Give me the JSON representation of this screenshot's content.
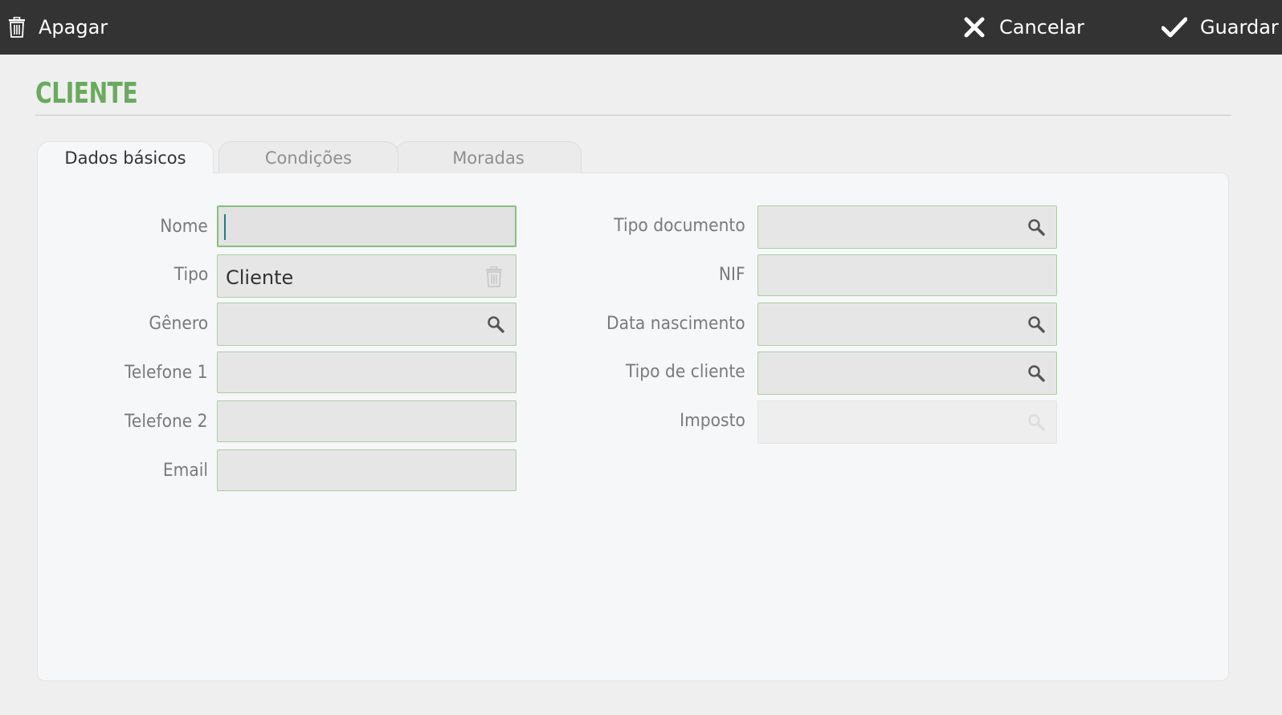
{
  "toolbar": {
    "delete_label": "Apagar",
    "cancel_label": "Cancelar",
    "save_label": "Guardar"
  },
  "page": {
    "title": "CLIENTE"
  },
  "tabs": [
    {
      "label": "Dados básicos",
      "active": true
    },
    {
      "label": "Condições",
      "active": false
    },
    {
      "label": "Moradas",
      "active": false
    }
  ],
  "form": {
    "left": [
      {
        "label": "Nome",
        "value": "",
        "icon": "none",
        "state": "focused"
      },
      {
        "label": "Tipo",
        "value": "Cliente",
        "icon": "trash-icon",
        "state": "normal"
      },
      {
        "label": "Gênero",
        "value": "",
        "icon": "search-icon",
        "state": "normal"
      },
      {
        "label": "Telefone 1",
        "value": "",
        "icon": "none",
        "state": "normal"
      },
      {
        "label": "Telefone 2",
        "value": "",
        "icon": "none",
        "state": "normal"
      },
      {
        "label": "Email",
        "value": "",
        "icon": "none",
        "state": "normal"
      }
    ],
    "right": [
      {
        "label": "Tipo documento",
        "value": "",
        "icon": "search-icon",
        "state": "normal"
      },
      {
        "label": "NIF",
        "value": "",
        "icon": "none",
        "state": "normal"
      },
      {
        "label": "Data nascimento",
        "value": "",
        "icon": "search-icon",
        "state": "normal"
      },
      {
        "label": "Tipo de cliente",
        "value": "",
        "icon": "search-icon",
        "state": "normal"
      },
      {
        "label": "Imposto",
        "value": "",
        "icon": "search-icon",
        "state": "disabled"
      }
    ]
  },
  "colors": {
    "toolbar_bg": "#333333",
    "accent_green": "#6aaa5e",
    "input_border": "#a9cfa1",
    "panel_bg": "#f6f7f9"
  }
}
